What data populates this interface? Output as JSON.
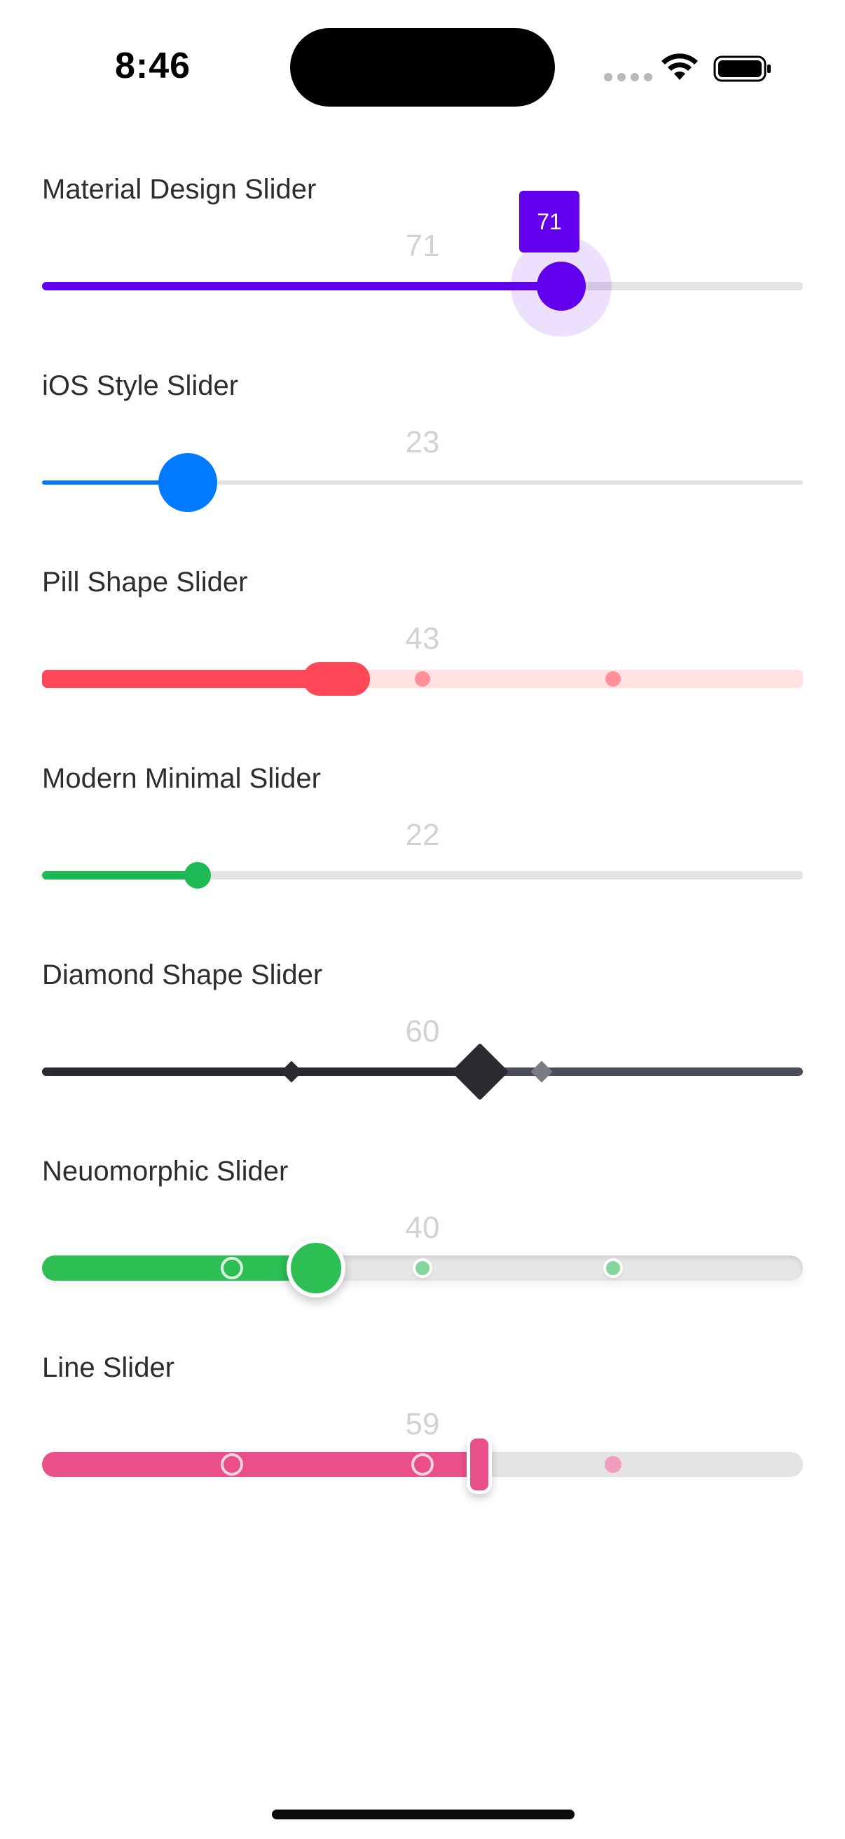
{
  "status_bar": {
    "time": "8:46",
    "icons": [
      "signal-dots-icon",
      "wifi-icon",
      "battery-icon"
    ]
  },
  "sliders": [
    {
      "title": "Material Design Slider",
      "value": "71",
      "tooltip": "71",
      "fraction": 0.71,
      "accent": "#6200EE"
    },
    {
      "title": "iOS Style Slider",
      "value": "23",
      "fraction": 0.23,
      "accent": "#007AFF"
    },
    {
      "title": "Pill Shape Slider",
      "value": "43",
      "fraction": 0.43,
      "accent": "#FF4757"
    },
    {
      "title": "Modern Minimal Slider",
      "value": "22",
      "fraction": 0.22,
      "accent": "#1DB954"
    },
    {
      "title": "Diamond Shape Slider",
      "value": "60",
      "fraction": 0.6,
      "accent": "#2B2B2F"
    },
    {
      "title": "Neuomorphic Slider",
      "value": "40",
      "fraction": 0.4,
      "accent": "#2DBE54"
    },
    {
      "title": "Line Slider",
      "value": "59",
      "fraction": 0.59,
      "accent": "#E9508A"
    }
  ]
}
